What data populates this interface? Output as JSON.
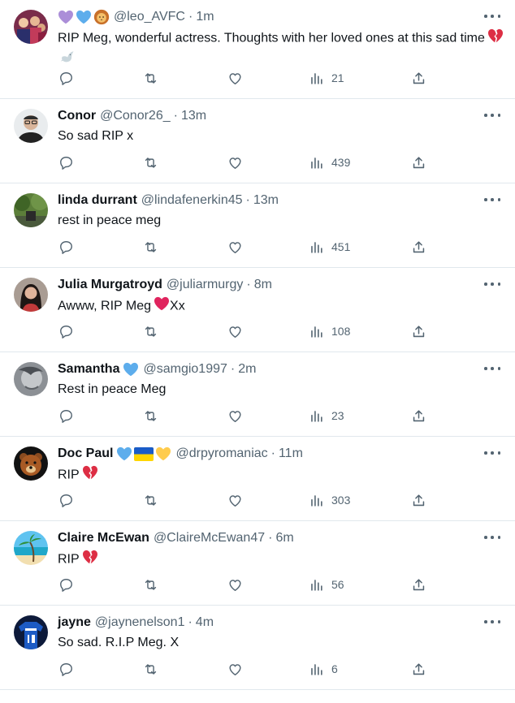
{
  "tweets": [
    {
      "name": "",
      "badges": [
        "purple-heart",
        "blue-heart",
        "lion"
      ],
      "handle": "@leo_AVFC",
      "time": "1m",
      "text": "RIP Meg, wonderful actress. Thoughts with her loved ones at this sad time",
      "emoji": [
        "broken-heart",
        "dove"
      ],
      "views": "21",
      "avatar": "crowd"
    },
    {
      "name": "Conor",
      "badges": [],
      "handle": "@Conor26_",
      "time": "13m",
      "text": "So sad RIP x",
      "emoji": [],
      "views": "439",
      "avatar": "man-glasses"
    },
    {
      "name": "linda durrant",
      "badges": [],
      "handle": "@lindafenerkin45",
      "time": "13m",
      "text": "rest in peace meg",
      "emoji": [],
      "views": "451",
      "avatar": "garden"
    },
    {
      "name": "Julia Murgatroyd",
      "badges": [],
      "handle": "@juliarmurgy",
      "time": "8m",
      "text": "Awww, RIP Meg",
      "text_after": "Xx",
      "emoji": [
        "red-heart"
      ],
      "views": "108",
      "avatar": "woman-dark-hair"
    },
    {
      "name": "Samantha",
      "badges": [
        "blue-heart"
      ],
      "handle": "@samgio1997",
      "time": "2m",
      "text": "Rest in peace Meg",
      "emoji": [],
      "views": "23",
      "avatar": "grey-face"
    },
    {
      "name": "Doc Paul",
      "badges": [
        "blue-heart",
        "ukraine-flag",
        "yellow-heart"
      ],
      "handle": "@drpyromaniac",
      "time": "11m",
      "text": "RIP",
      "emoji": [
        "broken-heart"
      ],
      "views": "303",
      "avatar": "bear"
    },
    {
      "name": "Claire McEwan",
      "badges": [],
      "handle": "@ClaireMcEwan47",
      "time": "6m",
      "text": "RIP",
      "emoji": [
        "broken-heart"
      ],
      "views": "56",
      "avatar": "beach"
    },
    {
      "name": "jayne",
      "badges": [],
      "handle": "@jaynenelson1",
      "time": "4m",
      "text": "So sad. R.I.P Meg. X",
      "emoji": [],
      "views": "6",
      "avatar": "football-shirt"
    }
  ],
  "colors": {
    "text": "#0f1419",
    "secondary": "#536471",
    "divider": "#e1e8ed",
    "heart-red": "#e0245e"
  }
}
